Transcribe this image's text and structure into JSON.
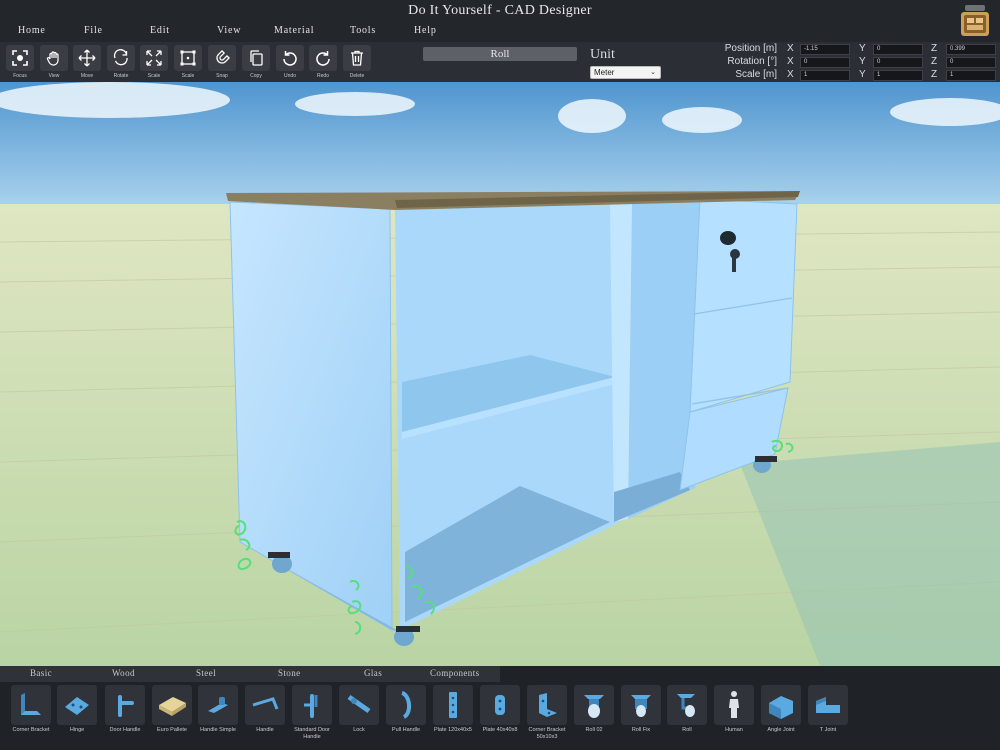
{
  "window": {
    "title": "Do It Yourself - CAD Designer"
  },
  "menu": [
    "Home",
    "File",
    "Edit",
    "View",
    "Material",
    "Tools",
    "Help"
  ],
  "toolbar": {
    "tools": [
      {
        "label": "Focus",
        "icon": "focus-icon"
      },
      {
        "label": "View",
        "icon": "hand-icon"
      },
      {
        "label": "Move",
        "icon": "move-icon"
      },
      {
        "label": "Rotate",
        "icon": "rotate-icon"
      },
      {
        "label": "Scale",
        "icon": "scale-expand-icon"
      },
      {
        "label": "Scale",
        "icon": "scale-box-icon"
      },
      {
        "label": "Snap",
        "icon": "magnet-icon"
      },
      {
        "label": "Copy",
        "icon": "copy-icon"
      },
      {
        "label": "Undo",
        "icon": "undo-icon"
      },
      {
        "label": "Redo",
        "icon": "redo-icon"
      },
      {
        "label": "Delete",
        "icon": "trash-icon"
      }
    ],
    "selected_object": "Roll",
    "unit_label": "Unit",
    "unit_value": "Meter"
  },
  "transform": {
    "position": {
      "label": "Position [m]",
      "x": "-1.15",
      "y": "0",
      "z": "0.399"
    },
    "rotation": {
      "label": "Rotation [°]",
      "x": "0",
      "y": "0",
      "z": "0"
    },
    "scale": {
      "label": "Scale [m]",
      "x": "1",
      "y": "1",
      "z": "1"
    },
    "axes": [
      "X",
      "Y",
      "Z"
    ]
  },
  "library": {
    "tabs": [
      "Basic",
      "Wood",
      "Steel",
      "Stone",
      "Glas",
      "Components"
    ],
    "parts": [
      {
        "label": "Corner Bracket",
        "icon": "corner-bracket-icon"
      },
      {
        "label": "Hinge",
        "icon": "hinge-icon"
      },
      {
        "label": "Door Handle",
        "icon": "door-handle-icon"
      },
      {
        "label": "Euro Pallete",
        "icon": "euro-pallet-icon"
      },
      {
        "label": "Handle Simple",
        "icon": "handle-simple-icon"
      },
      {
        "label": "Handle",
        "icon": "handle-icon"
      },
      {
        "label": "Standard Door Handle",
        "icon": "standard-door-handle-icon"
      },
      {
        "label": "Lock",
        "icon": "lock-icon"
      },
      {
        "label": "Pull Handle",
        "icon": "pull-handle-icon"
      },
      {
        "label": "Plate 120x40x5",
        "icon": "plate-long-icon"
      },
      {
        "label": "Plate 40x40x8",
        "icon": "plate-short-icon"
      },
      {
        "label": "Corner Bracket 50x10x3",
        "icon": "corner-bracket-small-icon"
      },
      {
        "label": "Roll 02",
        "icon": "caster-icon"
      },
      {
        "label": "Roll Fix",
        "icon": "caster-fixed-icon"
      },
      {
        "label": "Roll",
        "icon": "caster-swivel-icon"
      },
      {
        "label": "Human",
        "icon": "human-icon"
      },
      {
        "label": "Angle Joint",
        "icon": "angle-joint-icon"
      },
      {
        "label": "T Joint",
        "icon": "t-joint-icon"
      }
    ]
  },
  "colors": {
    "accent_blue": "#5aa9e0",
    "selection_blue": "#a8d8ff",
    "gizmo_green": "#55e07a"
  }
}
